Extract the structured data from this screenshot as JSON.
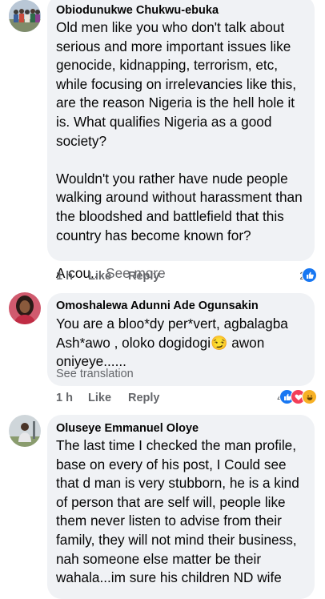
{
  "comments": [
    {
      "author": "Obiodunukwe Chukwu-ebuka",
      "paragraphs": [
        "Old men like you who don't talk about serious and more important issues like genocide, kidnapping, terrorism, etc, while focusing on irrelevancies like this, are the reason Nigeria is the hell hole it is. What qualifies Nigeria as a good society?",
        "Wouldn't you rather have nude people walking around without harassment than the bloodshed and battlefield that this country has become known for?"
      ],
      "truncated_text": "A cou...",
      "see_more": "See more",
      "time": "1 h",
      "like": "Like",
      "reply": "Reply",
      "reaction_count": "2",
      "reaction_icons": [
        "like-icon"
      ]
    },
    {
      "author": "Omoshalewa Adunni Ade Ogunsakin",
      "text": "You are a bloo*dy per*vert, agbalagba Ash*awo , oloko dogidogi😏 awon oniyeye......",
      "see_translation": "See translation",
      "time": "1 h",
      "like": "Like",
      "reply": "Reply",
      "reaction_count": "4",
      "reaction_icons": [
        "like-icon",
        "love-icon",
        "haha-icon"
      ]
    },
    {
      "author": "Oluseye Emmanuel Oloye",
      "text": "The last time I checked the man profile, base on every of his post,  I Could see that d man is very stubborn, he is a kind of person that are self will, people like them never listen to advise from their family, they will not mind their business, nah someone else  matter be their wahala...im sure his children ND wife"
    }
  ]
}
